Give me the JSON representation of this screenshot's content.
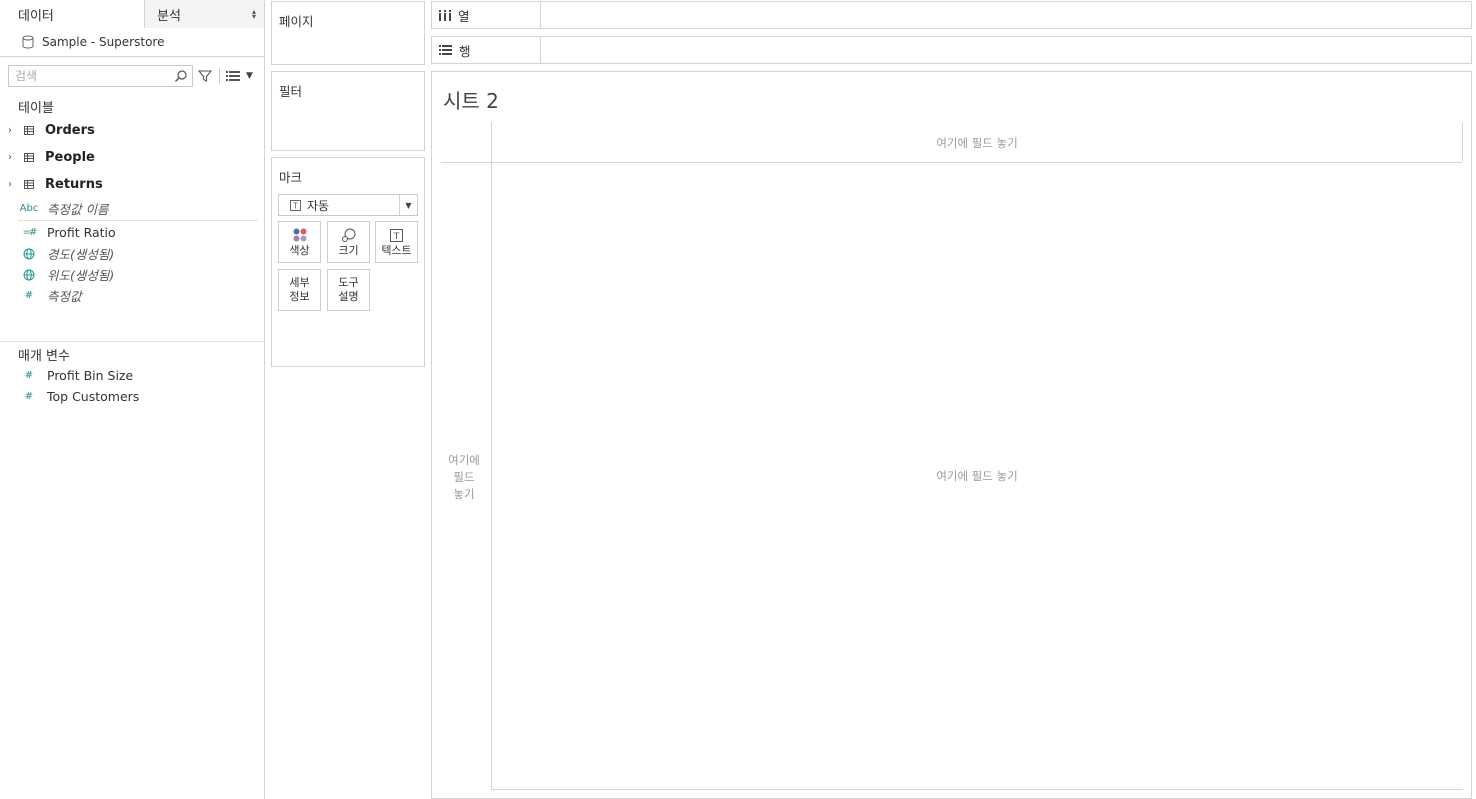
{
  "left_pane": {
    "tab_data": "데이터",
    "tab_analysis": "분석",
    "datasource": "Sample - Superstore",
    "search_placeholder": "검색",
    "tables_header": "테이블",
    "tables": [
      "Orders",
      "People",
      "Returns"
    ],
    "fields": [
      {
        "icon": "abc-string-icon",
        "icon_text": "Abc",
        "label": "측정값 이름",
        "italic": true
      },
      {
        "icon": "calculated-measure-icon",
        "icon_text": "=#",
        "label": "Profit Ratio",
        "italic": false
      },
      {
        "icon": "globe-icon",
        "icon_text": "",
        "label": "경도(생성됨)",
        "italic": true
      },
      {
        "icon": "globe-icon",
        "icon_text": "",
        "label": "위도(생성됨)",
        "italic": true
      },
      {
        "icon": "measure-icon",
        "icon_text": "#",
        "label": "측정값",
        "italic": true
      }
    ],
    "parameters_header": "매개 변수",
    "parameters": [
      "Profit Bin Size",
      "Top Customers"
    ]
  },
  "cards": {
    "pages": "페이지",
    "filters": "필터",
    "marks": "마크",
    "mark_type": "자동",
    "mark_buttons": {
      "color": "색상",
      "size": "크기",
      "text": "텍스트",
      "detail_1": "세부",
      "detail_2": "정보",
      "tooltip_1": "도구",
      "tooltip_2": "설명"
    }
  },
  "shelves": {
    "columns": "열",
    "rows": "행"
  },
  "view": {
    "sheet_title": "시트 2",
    "drop_top": "여기에 필드 놓기",
    "drop_center": "여기에 필드 놓기",
    "drop_left_1": "여기에",
    "drop_left_2": "필드",
    "drop_left_3": "놓기"
  },
  "colors": {
    "border": "#d4d4d4",
    "measure_green": "#1f9c8c",
    "string_blue": "#4a6fa5"
  }
}
